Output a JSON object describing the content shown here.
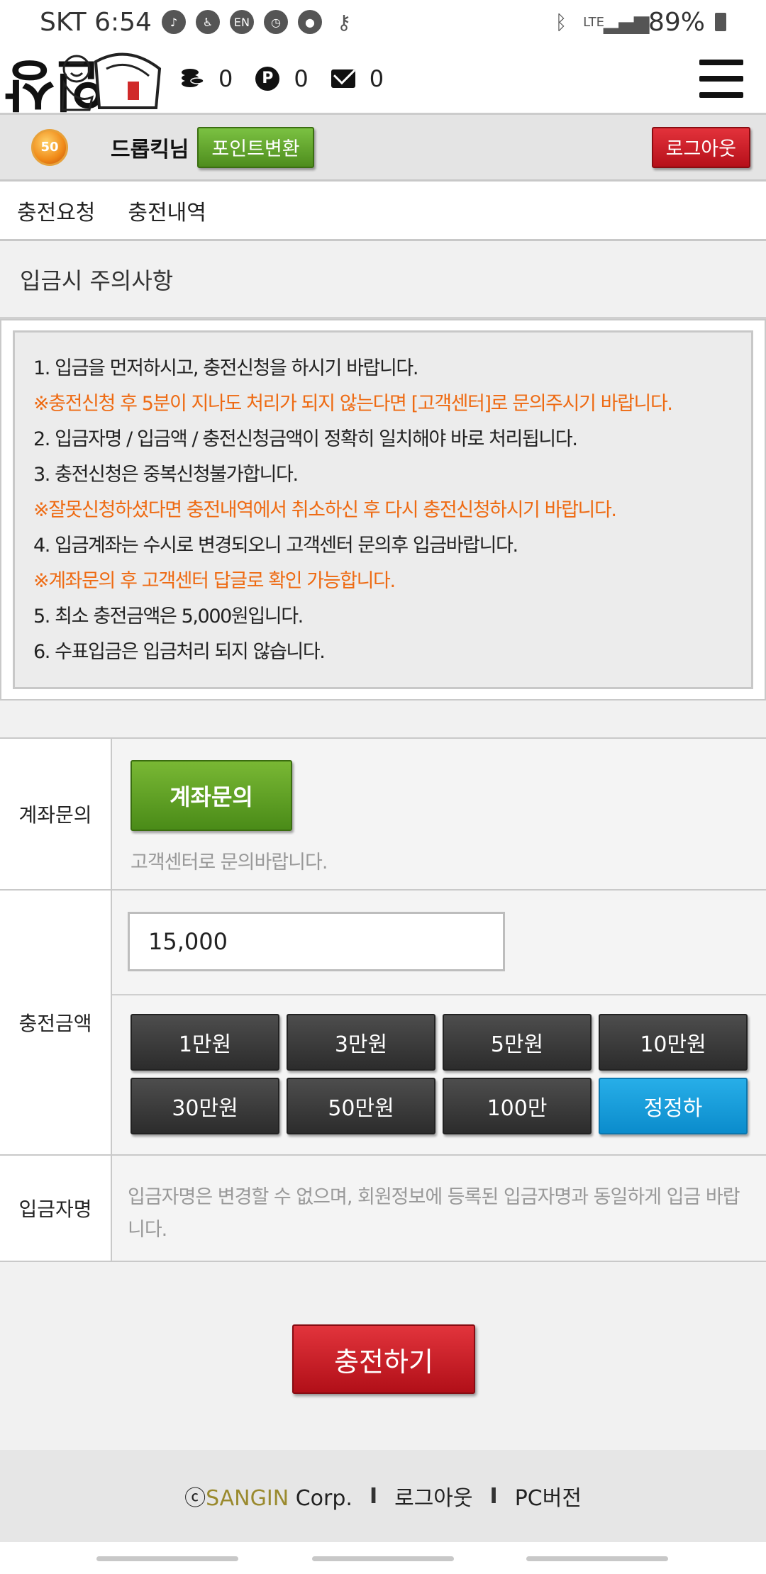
{
  "status_bar": {
    "carrier_time": "SKT 6:54",
    "network": "LTE",
    "battery": "89%",
    "icons": [
      "music-icon",
      "accessibility-icon",
      "vpn-icon",
      "clock-icon",
      "chat-icon",
      "key-icon",
      "bluetooth-icon",
      "signal-icon",
      "battery-icon"
    ]
  },
  "header": {
    "logo_text": "상인",
    "coin_count": "0",
    "point_label": "P",
    "point_count": "0",
    "message_count": "0"
  },
  "userbar": {
    "level": "50",
    "username": "드롭킥님",
    "convert_button": "포인트변환",
    "logout_button": "로그아웃"
  },
  "tabs": [
    "충전요청",
    "충전내역"
  ],
  "notice": {
    "title": "입금시 주의사항",
    "lines": [
      {
        "text": "1. 입금을 먼저하시고, 충전신청을 하시기 바랍니다.",
        "warn": false
      },
      {
        "text": "※충전신청 후 5분이 지나도 처리가 되지 않는다면 [고객센터]로 문의주시기 바랍니다.",
        "warn": true
      },
      {
        "text": "2. 입금자명 / 입금액 / 충전신청금액이 정확히 일치해야 바로 처리됩니다.",
        "warn": false
      },
      {
        "text": "3. 충전신청은 중복신청불가합니다.",
        "warn": false
      },
      {
        "text": "※잘못신청하셨다면 충전내역에서 취소하신 후 다시 충전신청하시기 바랍니다.",
        "warn": true
      },
      {
        "text": "4. 입금계좌는 수시로 변경되오니 고객센터 문의후 입금바랍니다.",
        "warn": false
      },
      {
        "text": "※계좌문의 후 고객센터 답글로 확인 가능합니다.",
        "warn": true
      },
      {
        "text": "5. 최소 충전금액은 5,000원입니다.",
        "warn": false
      },
      {
        "text": "6. 수표입금은 입금처리 되지 않습니다.",
        "warn": false
      }
    ]
  },
  "form": {
    "account_label": "계좌문의",
    "account_button": "계좌문의",
    "account_hint": "고객센터로 문의바랍니다.",
    "amount_label": "충전금액",
    "amount_value": "15,000",
    "amount_buttons": [
      "1만원",
      "3만원",
      "5만원",
      "10만원",
      "30만원",
      "50만원",
      "100만",
      "정정하"
    ],
    "depositor_label": "입금자명",
    "depositor_note": "입금자명은 변경할 수 없으며, 회원정보에 등록된 입금자명과 동일하게 입금 바랍니다."
  },
  "submit_button": "충전하기",
  "footer": {
    "copyright_symbol": "ⓒ",
    "brand": "SANGIN",
    "corp": " Corp.",
    "separator": "I",
    "logout_link": "로그아웃",
    "pc_link": "PC버전"
  },
  "colors": {
    "warn": "#ee6a12",
    "green": "#5a9b22",
    "red": "#c8141e",
    "blue": "#1a9ddb",
    "dark_button": "#3a3a3a",
    "brand": "#9a8a2e"
  }
}
